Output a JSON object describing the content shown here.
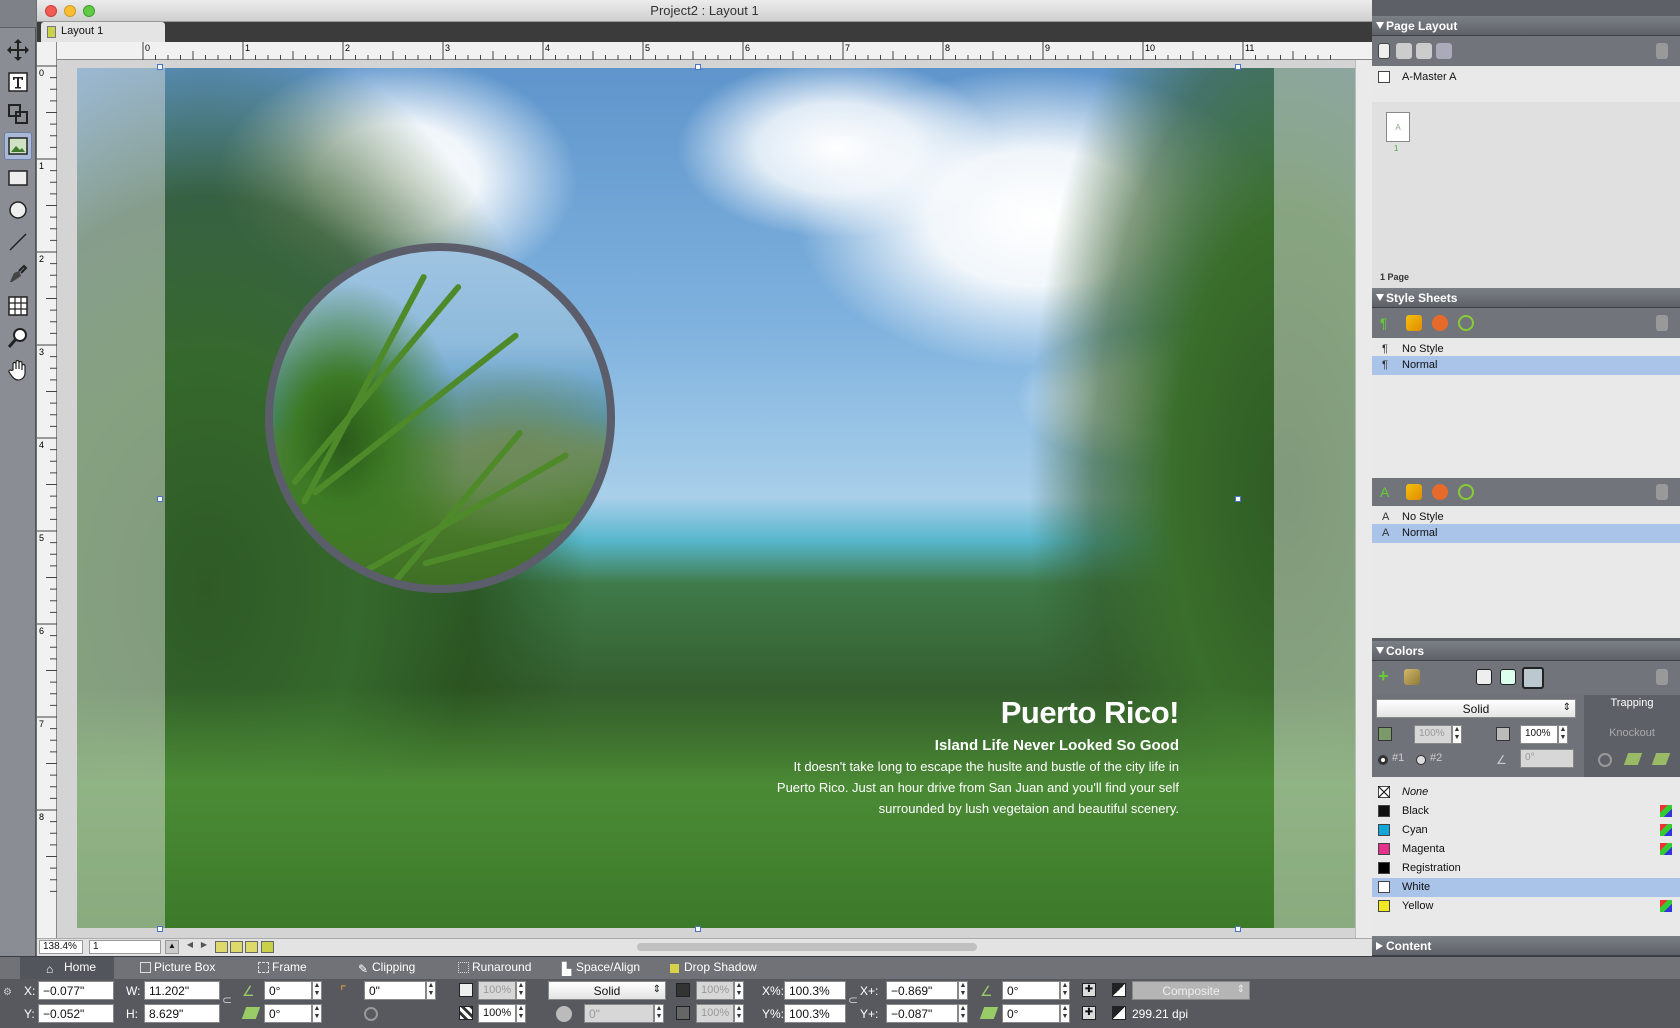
{
  "app": {
    "window_title": "Project2 : Layout 1",
    "tab_label": "Layout 1"
  },
  "rulers": {
    "h_ticks": [
      "0",
      "1",
      "2",
      "3",
      "4",
      "5",
      "6",
      "7",
      "8",
      "9",
      "10",
      "11"
    ],
    "v_ticks": [
      "0",
      "1",
      "2",
      "3",
      "4",
      "5",
      "6",
      "7",
      "8"
    ]
  },
  "canvas": {
    "headline": "Puerto Rico!",
    "subheadline": "Island Life Never Looked So Good",
    "body": "It doesn't take long to escape the huslte and bustle of the city life in Puerto Rico. Just an hour drive from San Juan and you'll find your self surrounded by lush vegetaion and beautiful scenery."
  },
  "doc_status": {
    "zoom": "138.4%",
    "page": "1"
  },
  "palettes": {
    "page_layout": {
      "title": "Page Layout",
      "master": "A-Master A",
      "page_label": "A",
      "page_number": "1",
      "page_count": "1 Page"
    },
    "style_sheets": {
      "title": "Style Sheets",
      "paragraph": [
        "No Style",
        "Normal"
      ],
      "character": [
        "No Style",
        "Normal"
      ]
    },
    "colors": {
      "title": "Colors",
      "mode": "Solid",
      "trapping_label": "Trapping",
      "trapping_value": "Knockout",
      "shade1": "100%",
      "shade2": "100%",
      "radio1": "#1",
      "radio2": "#2",
      "angle": "0°",
      "list": [
        {
          "name": "None",
          "color": "none"
        },
        {
          "name": "Black",
          "color": "#111111"
        },
        {
          "name": "Cyan",
          "color": "#12a7d8"
        },
        {
          "name": "Magenta",
          "color": "#e5318a"
        },
        {
          "name": "Registration",
          "color": "#000000"
        },
        {
          "name": "White",
          "color": "#ffffff"
        },
        {
          "name": "Yellow",
          "color": "#f4ea24"
        }
      ]
    },
    "content": {
      "title": "Content"
    }
  },
  "measurements": {
    "tabs": [
      "Home",
      "Picture Box",
      "Frame",
      "Clipping",
      "Runaround",
      "Space/Align",
      "Drop Shadow"
    ],
    "x_label": "X:",
    "x": "−0.077\"",
    "y_label": "Y:",
    "y": "−0.052\"",
    "w_label": "W:",
    "w": "11.202\"",
    "h_label": "H:",
    "h": "8.629\"",
    "angle1": "0°",
    "angle2": "0°",
    "corner": "0\"",
    "opacity1": "100%",
    "opacity2": "100%",
    "frame_style": "Solid",
    "frame_width": "0\"",
    "frame_opacity1": "100%",
    "frame_opacity2": "100%",
    "scale_x_label": "X%:",
    "scale_x": "100.3%",
    "scale_y_label": "Y%:",
    "scale_y": "100.3%",
    "offset_x_label": "X+:",
    "offset_x": "−0.869\"",
    "offset_y_label": "Y+:",
    "offset_y": "−0.087\"",
    "pic_angle": "0°",
    "pic_skew": "0°",
    "composite": "Composite",
    "dpi": "299.21 dpi"
  }
}
